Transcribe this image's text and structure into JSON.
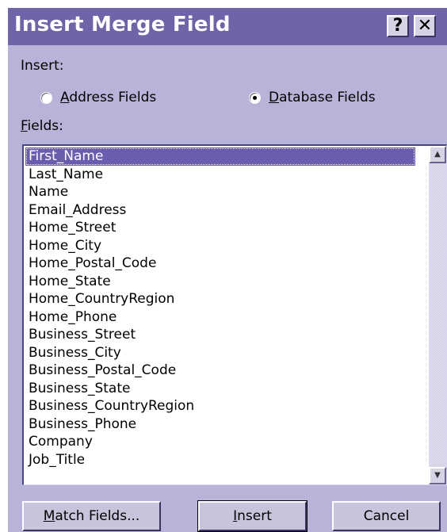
{
  "window": {
    "title": "Insert Merge Field",
    "help_button": "?",
    "close_button": "✕"
  },
  "insert": {
    "label": "Insert:",
    "address_fields": {
      "access_key": "A",
      "rest": "ddress Fields",
      "selected": false
    },
    "database_fields": {
      "access_key": "D",
      "rest": "atabase Fields",
      "selected": true
    }
  },
  "fields": {
    "label_key": "F",
    "label_rest": "ields:",
    "selected_index": 0,
    "items": [
      "First_Name",
      "Last_Name",
      "Name",
      "Email_Address",
      "Home_Street",
      "Home_City",
      "Home_Postal_Code",
      "Home_State",
      "Home_CountryRegion",
      "Home_Phone",
      "Business_Street",
      "Business_City",
      "Business_Postal_Code",
      "Business_State",
      "Business_CountryRegion",
      "Business_Phone",
      "Company",
      "Job_Title"
    ]
  },
  "buttons": {
    "match_fields": {
      "access_key": "M",
      "rest": "atch Fields..."
    },
    "insert": {
      "access_key": "I",
      "rest": "nsert"
    },
    "cancel": {
      "label": "Cancel"
    }
  },
  "icons": {
    "scroll_up": "scroll-up-arrow-icon",
    "scroll_down": "scroll-down-arrow-icon",
    "help": "question-mark-icon",
    "close": "close-icon"
  },
  "colors": {
    "title_bar": "#6d65a8",
    "dialog_face": "#b8b3d8",
    "selection": "#6b5cb0"
  }
}
